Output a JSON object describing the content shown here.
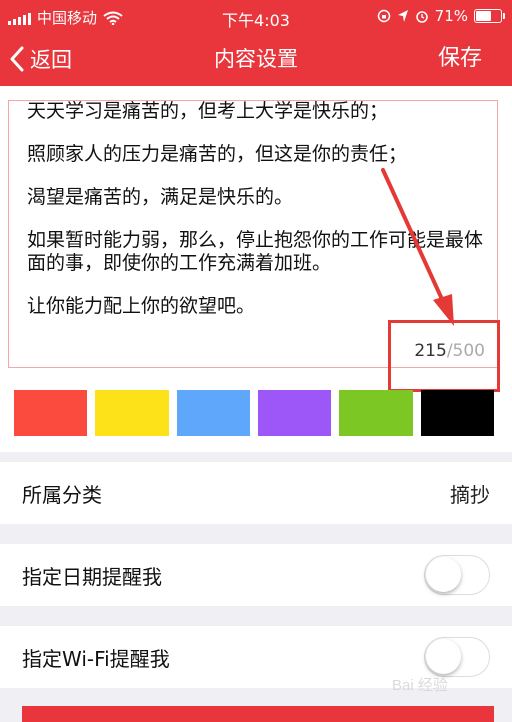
{
  "status_bar": {
    "carrier": "中国移动",
    "time": "下午4:03",
    "battery_text": "71%",
    "battery_level": 0.71
  },
  "nav": {
    "back_label": "返回",
    "title": "内容设置",
    "save_label": "保存"
  },
  "editor": {
    "paragraphs": [
      "天天学习是痛苦的，但考上大学是快乐的；",
      "照顾家人的压力是痛苦的，但这是你的责任；",
      "渴望是痛苦的，满足是快乐的。",
      "如果暂时能力弱，那么，停止抱怨你的工作可能是最体面的事，即使你的工作充满着加班。",
      "让你能力配上你的欲望吧。"
    ],
    "count_current": "215",
    "count_max": "/500"
  },
  "colors": [
    "#fb4a3e",
    "#fde119",
    "#5ea7fb",
    "#9d56f7",
    "#7dc724",
    "#000000"
  ],
  "category": {
    "label": "所属分类",
    "value": "摘抄"
  },
  "remind_date": {
    "label": "指定日期提醒我",
    "on": false
  },
  "remind_wifi": {
    "label": "指定Wi-Fi提醒我",
    "on": false
  },
  "watermark": "Bai 经验"
}
